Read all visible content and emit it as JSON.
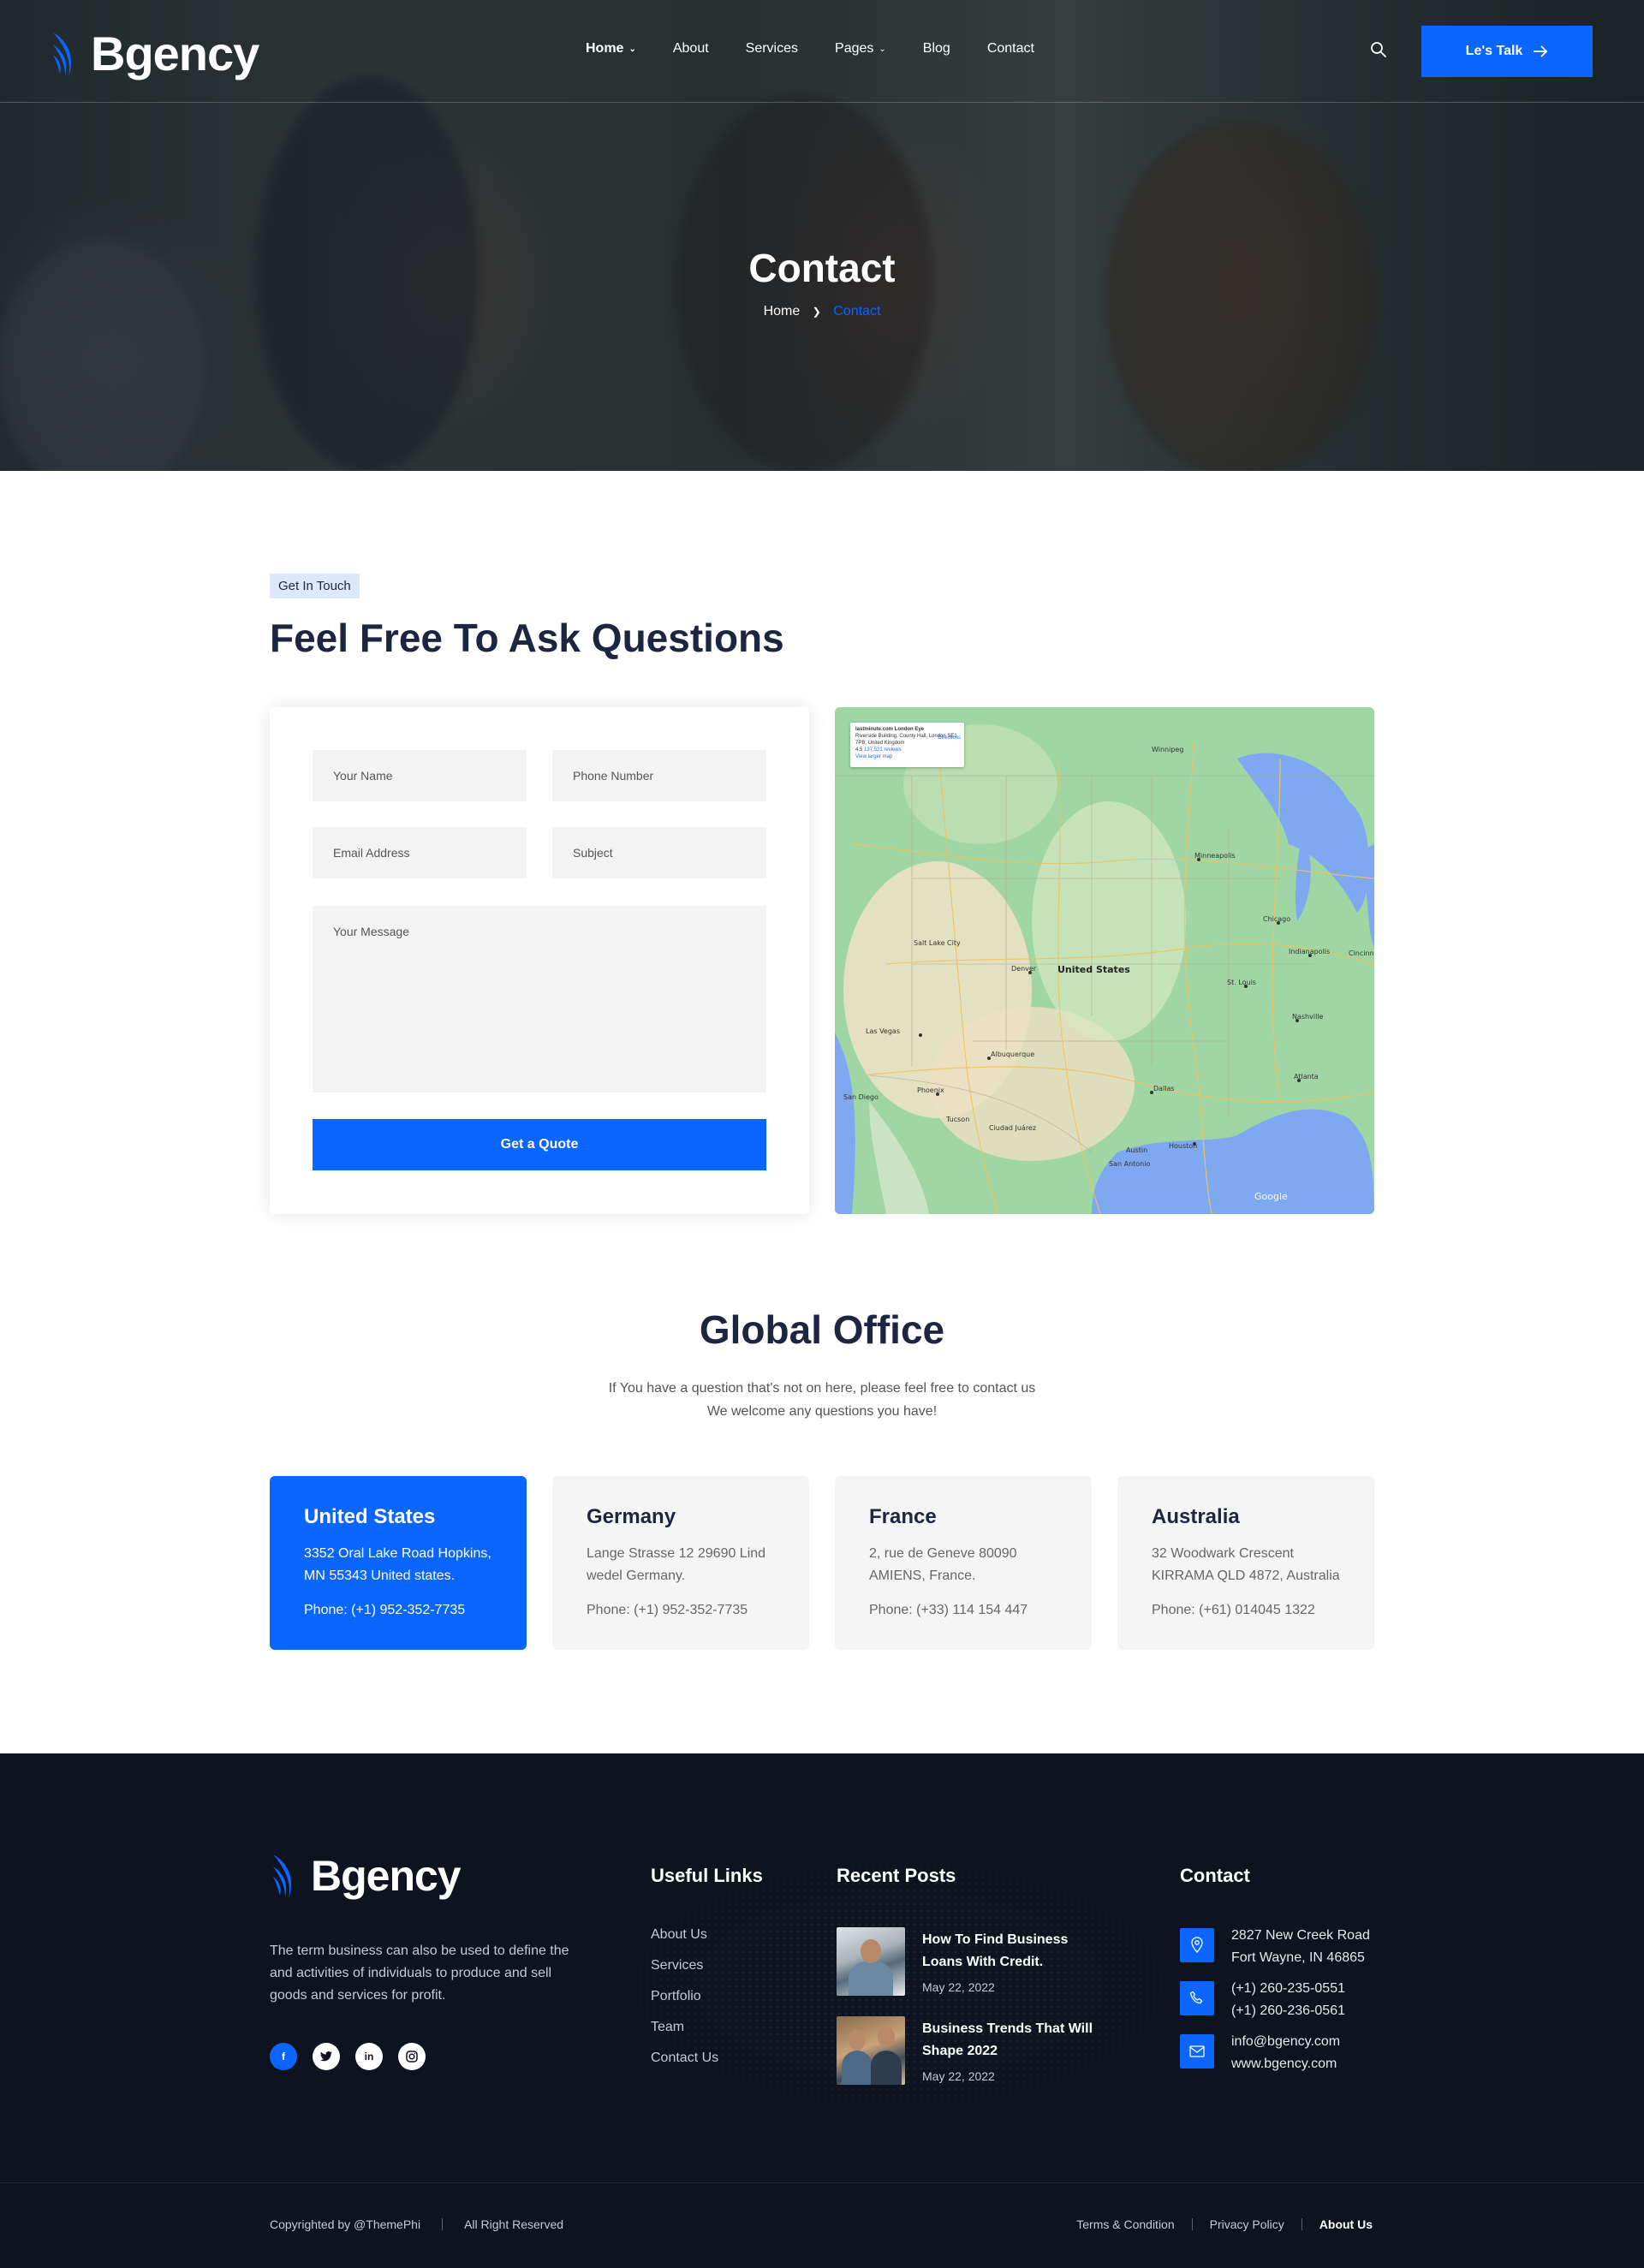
{
  "brand": {
    "name": "Bgency"
  },
  "nav": {
    "items": [
      {
        "label": "Home",
        "has_dropdown": true,
        "active": true
      },
      {
        "label": "About"
      },
      {
        "label": "Services"
      },
      {
        "label": "Pages",
        "has_dropdown": true
      },
      {
        "label": "Blog"
      },
      {
        "label": "Contact"
      }
    ],
    "search_icon": "search-icon",
    "cta_label": "Le's Talk",
    "cta_icon": "arrow-right-icon"
  },
  "hero": {
    "title": "Contact",
    "breadcrumb": {
      "home": "Home",
      "current": "Contact"
    }
  },
  "contact": {
    "tag": "Get In Touch",
    "title": "Feel Free To Ask Questions",
    "form": {
      "name_placeholder": "Your Name",
      "phone_placeholder": "Phone Number",
      "email_placeholder": "Email Address",
      "subject_placeholder": "Subject",
      "message_placeholder": "Your Message",
      "submit_label": "Get a Quote"
    },
    "map": {
      "place_title": "lastminute.com London Eye",
      "place_address": "Riverside Building, County Hall, London SE1 7PB, United Kingdom",
      "rating": "4.5",
      "reviews": "137,521 reviews",
      "view_link": "View larger map",
      "directions": "Directions",
      "country_label": "United States",
      "attribution": "Google"
    }
  },
  "global_office": {
    "title": "Global Office",
    "subtitle_line1": "If You have a question that's not on here, please feel free to contact us",
    "subtitle_line2": "We welcome any questions you have!",
    "offices": [
      {
        "country": "United States",
        "address": "3352 Oral Lake Road Hopkins, MN 55343 United states.",
        "phone": "Phone: (+1) 952-352-7735"
      },
      {
        "country": "Germany",
        "address": "Lange Strasse 12 29690 Lind wedel Germany.",
        "phone": "Phone: (+1) 952-352-7735"
      },
      {
        "country": "France",
        "address": "2, rue de Geneve 80090 AMIENS, France.",
        "phone": "Phone: (+33) 114 154 447"
      },
      {
        "country": "Australia",
        "address": "32 Woodwark Crescent KIRRAMA QLD 4872, Australia",
        "phone": "Phone: (+61) 014045 1322"
      }
    ]
  },
  "footer": {
    "about": "The term business can also be used to define the and activities of individuals to produce and sell goods and services for profit.",
    "socials": [
      "facebook-icon",
      "twitter-icon",
      "linkedin-icon",
      "instagram-icon"
    ],
    "useful_links_title": "Useful Links",
    "useful_links": [
      "About Us",
      "Services",
      "Portfolio",
      "Team",
      "Contact Us"
    ],
    "recent_posts_title": "Recent Posts",
    "posts": [
      {
        "title": "How To Find Business Loans With Credit.",
        "date": "May 22, 2022"
      },
      {
        "title": "Business Trends That Will Shape 2022",
        "date": "May 22, 2022"
      }
    ],
    "contact_title": "Contact",
    "contact": {
      "address_line1": "2827 New Creek Road",
      "address_line2": "Fort Wayne, IN 46865",
      "phone1": "(+1) 260-235-0551",
      "phone2": "(+1) 260-236-0561",
      "email": "info@bgency.com",
      "website": "www.bgency.com"
    },
    "copyright": "Copyrighted by @ThemePhi",
    "rights": "All Right Reserved",
    "bottom_links": [
      "Terms & Condition",
      "Privacy Policy",
      "About Us"
    ]
  },
  "colors": {
    "accent": "#0b65ff",
    "dark": "#0e1320",
    "heading": "#1c2640"
  }
}
